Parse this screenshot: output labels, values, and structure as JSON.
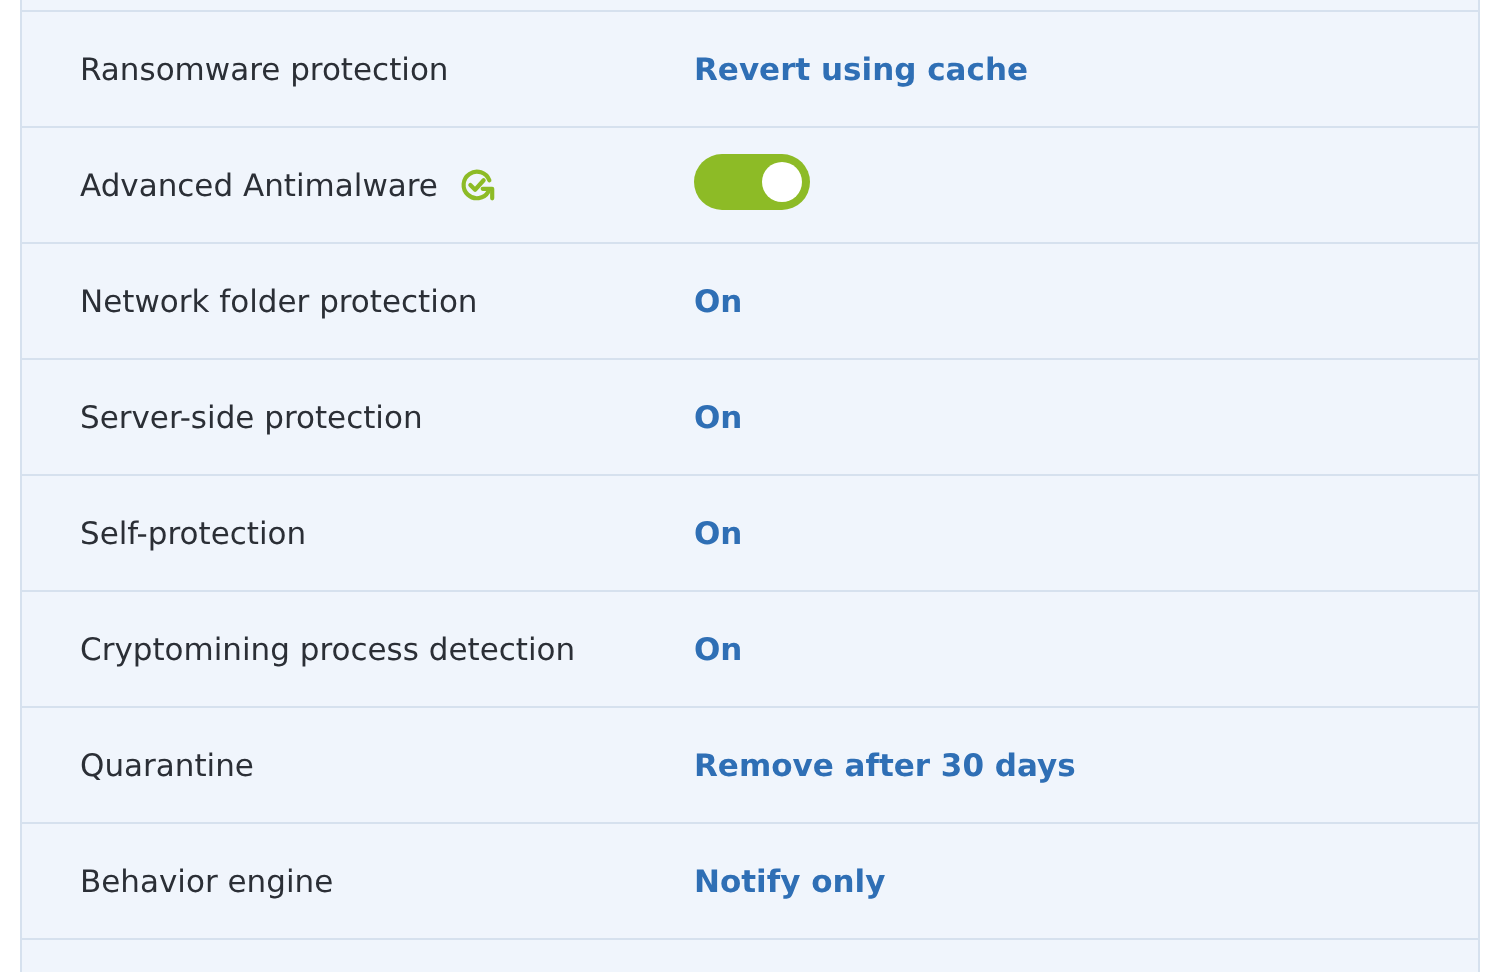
{
  "settings": [
    {
      "label": "Ransomware protection",
      "kind": "link",
      "value": "Revert using cache",
      "badge": false
    },
    {
      "label": "Advanced Antimalware",
      "kind": "toggle",
      "on": true,
      "badge": true
    },
    {
      "label": "Network folder protection",
      "kind": "link",
      "value": "On",
      "badge": false
    },
    {
      "label": "Server-side protection",
      "kind": "link",
      "value": "On",
      "badge": false
    },
    {
      "label": "Self-protection",
      "kind": "link",
      "value": "On",
      "badge": false
    },
    {
      "label": "Cryptomining process detection",
      "kind": "link",
      "value": "On",
      "badge": false
    },
    {
      "label": "Quarantine",
      "kind": "link",
      "value": "Remove after 30 days",
      "badge": false
    },
    {
      "label": "Behavior engine",
      "kind": "link",
      "value": "Notify only",
      "badge": false
    }
  ]
}
